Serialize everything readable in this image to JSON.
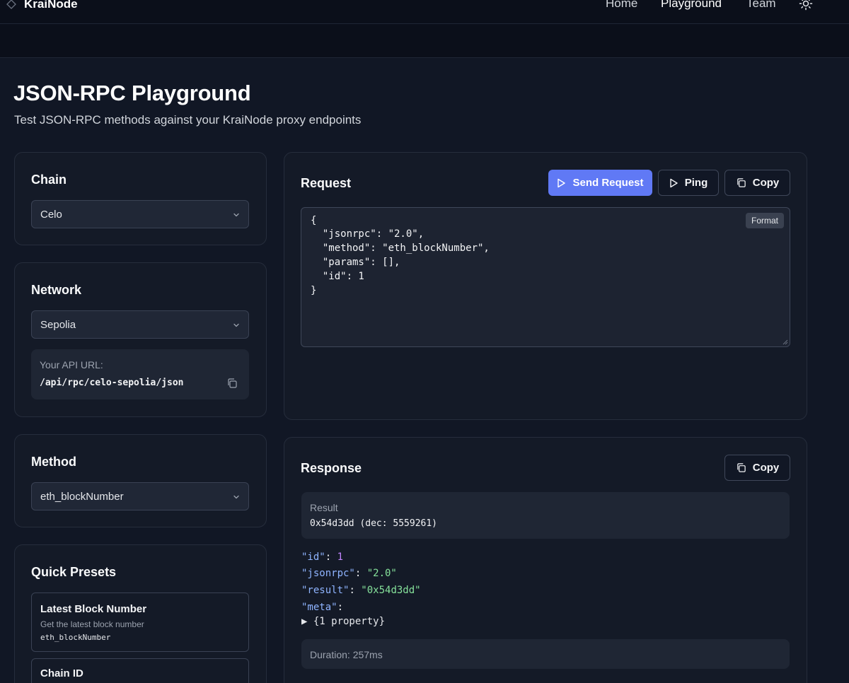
{
  "nav": {
    "brand": "KraiNode",
    "links": [
      {
        "label": "Home"
      },
      {
        "label": "Playground"
      },
      {
        "label": "Team"
      }
    ],
    "theme_icon": "sun-icon"
  },
  "header": {
    "title": "JSON-RPC Playground",
    "subtitle": "Test JSON-RPC methods against your KraiNode proxy endpoints"
  },
  "chain": {
    "title": "Chain",
    "selected": "Celo"
  },
  "network": {
    "title": "Network",
    "selected": "Sepolia",
    "api_url_label": "Your API URL:",
    "api_url": "/api/rpc/celo-sepolia/json"
  },
  "method": {
    "title": "Method",
    "selected": "eth_blockNumber"
  },
  "presets": {
    "title": "Quick Presets",
    "items": [
      {
        "name": "Latest Block Number",
        "description": "Get the latest block number",
        "method": "eth_blockNumber"
      },
      {
        "name": "Chain ID"
      }
    ]
  },
  "request": {
    "title": "Request",
    "send_label": "Send Request",
    "ping_label": "Ping",
    "copy_label": "Copy",
    "format_label": "Format",
    "lines": [
      "{",
      "  \"jsonrpc\": \"2.0\",",
      "  \"method\": \"eth_blockNumber\",",
      "  \"params\": [],",
      "  \"id\": 1",
      "}"
    ]
  },
  "response": {
    "title": "Response",
    "copy_label": "Copy",
    "result_label": "Result",
    "result_value": "0x54d3dd (dec: 5559261)",
    "json": {
      "id_key": "\"id\"",
      "id_val": "1",
      "jsonrpc_key": "\"jsonrpc\"",
      "jsonrpc_val": "\"2.0\"",
      "result_key": "\"result\"",
      "result_val": "\"0x54d3dd\"",
      "meta_key": "\"meta\"",
      "meta_collapsed": "{1 property}",
      "sep": ": "
    },
    "duration": "Duration: 257ms"
  },
  "colors": {
    "background": "#111725",
    "card": "#141a27",
    "accent": "#6079f5",
    "json_key": "#8fb4ff",
    "json_string": "#86e29b",
    "json_number": "#c084fc"
  }
}
